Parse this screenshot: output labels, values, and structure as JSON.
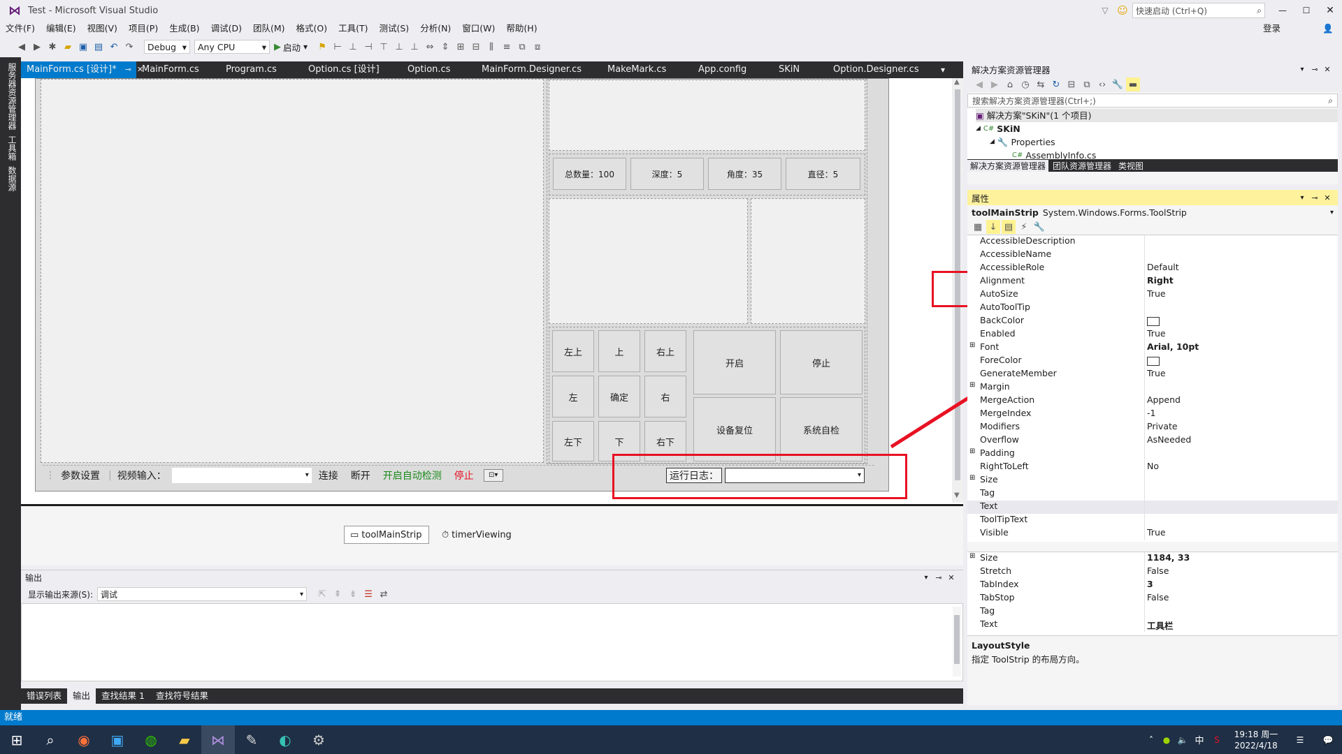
{
  "window": {
    "title": "Test - Microsoft Visual Studio",
    "quick_launch_placeholder": "快速启动 (Ctrl+Q)",
    "sign_in": "登录"
  },
  "menu": [
    "文件(F)",
    "编辑(E)",
    "视图(V)",
    "项目(P)",
    "生成(B)",
    "调试(D)",
    "团队(M)",
    "格式(O)",
    "工具(T)",
    "测试(S)",
    "分析(N)",
    "窗口(W)",
    "帮助(H)"
  ],
  "toolbar": {
    "config": "Debug",
    "platform": "Any CPU",
    "start": "启动"
  },
  "left_strip": [
    "服务器资源管理器",
    "工具箱",
    "数据源"
  ],
  "doc_tabs": [
    "MainForm.cs [设计]*",
    "MainForm.cs",
    "Program.cs",
    "Option.cs [设计]",
    "Option.cs",
    "MainForm.Designer.cs",
    "MakeMark.cs",
    "App.config",
    "SKiN",
    "Option.Designer.cs"
  ],
  "form": {
    "stats": [
      "总数量：100",
      "深度：5",
      "角度：35",
      "直径：5"
    ],
    "dir_buttons": [
      "左上",
      "上",
      "右上",
      "左",
      "确定",
      "右",
      "左下",
      "下",
      "右下"
    ],
    "action_buttons": [
      "开启",
      "停止",
      "设备复位",
      "系统自检"
    ],
    "strip": {
      "params": "参数设置",
      "video_label": "视频输入：",
      "connect": "连接",
      "disconnect": "断开",
      "auto_detect": "开启自动检测",
      "stop": "停止",
      "log_label": "运行日志："
    }
  },
  "tray": [
    "toolMainStrip",
    "timerViewing"
  ],
  "output": {
    "title": "输出",
    "source_label": "显示输出来源(S):",
    "source_value": "调试",
    "tabs": [
      "错误列表",
      "输出",
      "查找结果 1",
      "查找符号结果"
    ]
  },
  "solution": {
    "title": "解决方案资源管理器",
    "search": "搜索解决方案资源管理器(Ctrl+;)",
    "tree": [
      "解决方案\"SKiN\"(1 个项目)",
      "SKiN",
      "Properties",
      "AssemblyInfo.cs"
    ],
    "tabs": [
      "解决方案资源管理器",
      "团队资源管理器",
      "类视图"
    ]
  },
  "properties": {
    "title": "属性",
    "object_name": "toolMainStrip",
    "object_type": "System.Windows.Forms.ToolStrip",
    "rows": [
      {
        "k": "AccessibleDescription",
        "v": ""
      },
      {
        "k": "AccessibleName",
        "v": ""
      },
      {
        "k": "AccessibleRole",
        "v": "Default"
      },
      {
        "k": "Alignment",
        "v": "Right"
      },
      {
        "k": "AutoSize",
        "v": "True"
      },
      {
        "k": "AutoToolTip",
        "v": ""
      },
      {
        "k": "BackColor",
        "v": ""
      },
      {
        "k": "Enabled",
        "v": "True"
      },
      {
        "k": "Font",
        "v": "Arial, 10pt"
      },
      {
        "k": "ForeColor",
        "v": ""
      },
      {
        "k": "GenerateMember",
        "v": "True"
      },
      {
        "k": "Margin",
        "v": ""
      },
      {
        "k": "MergeAction",
        "v": "Append"
      },
      {
        "k": "MergeIndex",
        "v": "-1"
      },
      {
        "k": "Modifiers",
        "v": "Private"
      },
      {
        "k": "Overflow",
        "v": "AsNeeded"
      },
      {
        "k": "Padding",
        "v": ""
      },
      {
        "k": "RightToLeft",
        "v": "No"
      },
      {
        "k": "Size",
        "v": ""
      },
      {
        "k": "Tag",
        "v": ""
      },
      {
        "k": "Text",
        "v": ""
      },
      {
        "k": "ToolTipText",
        "v": ""
      },
      {
        "k": "Visible",
        "v": "True"
      }
    ],
    "rows2": [
      {
        "k": "Size",
        "v": "1184, 33"
      },
      {
        "k": "Stretch",
        "v": "False"
      },
      {
        "k": "TabIndex",
        "v": "3"
      },
      {
        "k": "TabStop",
        "v": "False"
      },
      {
        "k": "Tag",
        "v": ""
      },
      {
        "k": "Text",
        "v": "工具栏"
      }
    ],
    "desc_title": "LayoutStyle",
    "desc_text": "指定 ToolStrip 的布局方向。"
  },
  "status": "就绪",
  "clock": {
    "time": "19:18 周一",
    "date": "2022/4/18"
  },
  "colors": {
    "accent": "#007acc",
    "annotation": "#e81123"
  }
}
